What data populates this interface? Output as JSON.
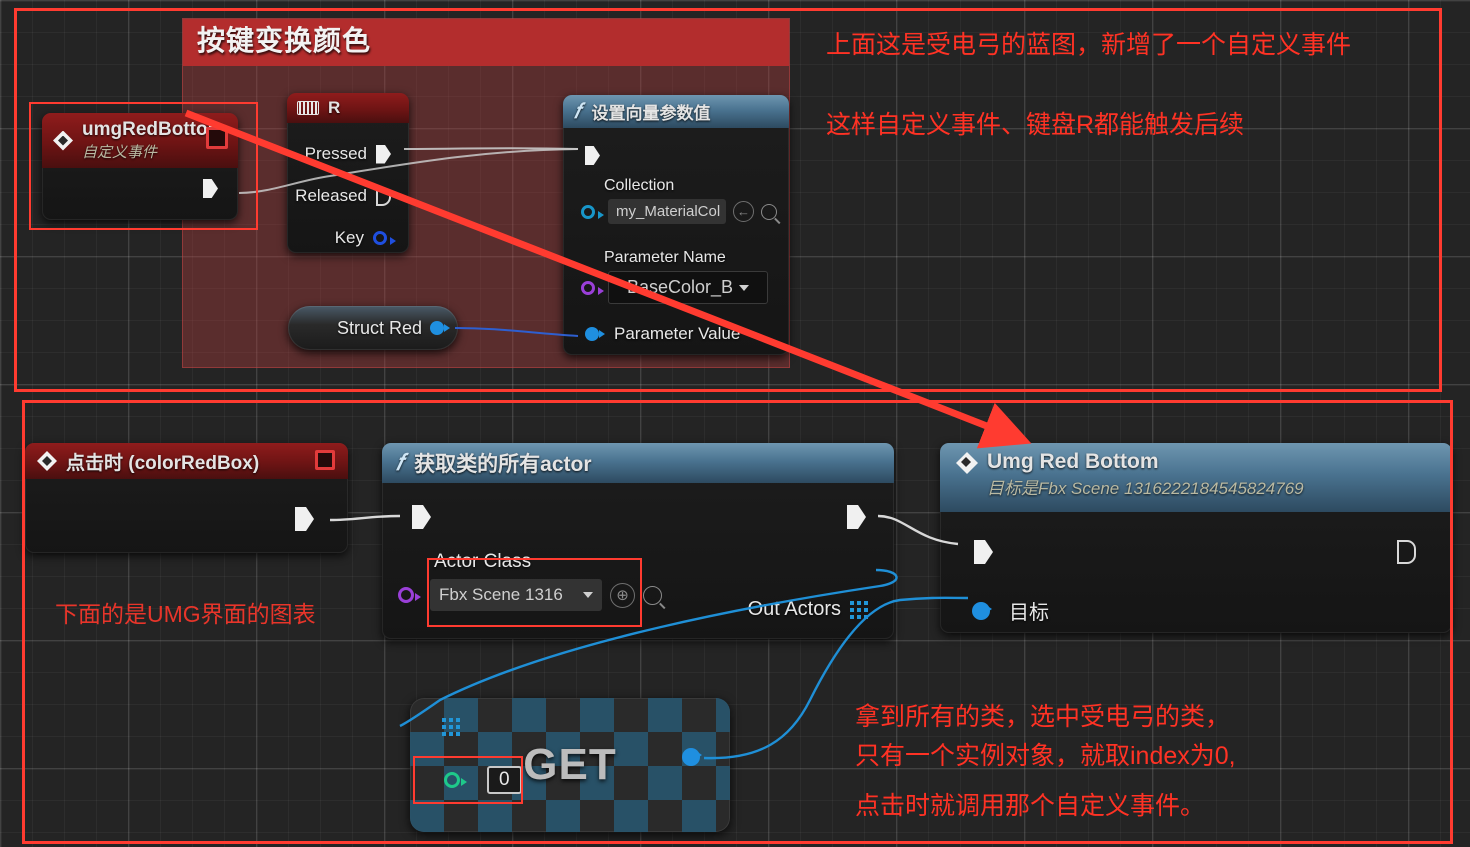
{
  "canvas": {
    "background_color": "#242424",
    "grid_color": "#3a3a3a"
  },
  "top_section": {
    "comment_box": {
      "title": "按键变换颜色",
      "header_color": "#b32d2d",
      "body_color": "#a83c3c"
    },
    "nodes": {
      "custom_event": {
        "title": "umgRedBottom",
        "subtitle": "自定义事件",
        "header_color": "#8f1c1c",
        "icon": "event-diamond-icon",
        "corner_icon": "stop-square-icon",
        "out_pins": [
          {
            "label": "",
            "type": "exec"
          }
        ]
      },
      "key_event": {
        "title": "R",
        "icon": "keyboard-icon",
        "header_color": "#8f1c1c",
        "pins": [
          {
            "label": "Pressed",
            "type": "exec",
            "filled": true
          },
          {
            "label": "Released",
            "type": "exec",
            "filled": false
          },
          {
            "label": "Key",
            "type": "data",
            "color": "#1f4fe0"
          }
        ]
      },
      "set_vector_param": {
        "title": "设置向量参数值",
        "icon": "function-f-icon",
        "header_color": "#4a7390",
        "exec_in": "",
        "fields": [
          {
            "label": "Collection",
            "value": "my_MaterialCol",
            "pin_color": "#1896c9",
            "has_browse": true,
            "has_search": true
          },
          {
            "label": "Parameter Name",
            "value": "BaseColor_B",
            "pin_color": "#9a3fd8"
          }
        ],
        "in_pins": [
          {
            "label": "Parameter Value",
            "color": "#1f8fe0"
          }
        ]
      },
      "struct_red": {
        "label": "Struct Red",
        "pin_color": "#1f8fe0"
      }
    },
    "annotations": [
      "上面这是受电弓的蓝图，新增了一个自定义事件",
      "这样自定义事件、键盘R都能触发后续"
    ]
  },
  "bottom_section": {
    "nodes": {
      "on_clicked": {
        "title": "点击时 (colorRedBox)",
        "icon": "event-diamond-icon",
        "corner_icon": "stop-square-icon",
        "header_color": "#8f1c1c"
      },
      "get_all_actors": {
        "title": "获取类的所有actor",
        "icon": "function-f-icon",
        "header_color": "#4a7390",
        "input_field": {
          "label": "Actor Class",
          "value": "Fbx Scene 1316",
          "pin_color": "#9a3fd8"
        },
        "output_field": {
          "label": "Out Actors",
          "pin": "array-grid-pin"
        }
      },
      "umg_red_bottom": {
        "title": "Umg Red Bottom",
        "subtitle": "目标是Fbx Scene 1316222184545824769",
        "icon": "event-diamond-icon",
        "header_color": "#4a7390",
        "target_pin_label": "目标",
        "target_pin_color": "#1f8fe0"
      },
      "get_node": {
        "label": "GET",
        "index_value": "0",
        "array_pin": "array-grid-pin",
        "index_pin_color": "#1ec98a",
        "out_pin_color": "#1f8fe0"
      }
    },
    "annotations": [
      "下面的是UMG界面的图表",
      "拿到所有的类，选中受电弓的类，\n只有一个实例对象，就取index为0,",
      "点击时就调用那个自定义事件。"
    ]
  },
  "markup": {
    "highlight_color": "#ff3b30",
    "annotation_text_color": "#ff3224"
  }
}
